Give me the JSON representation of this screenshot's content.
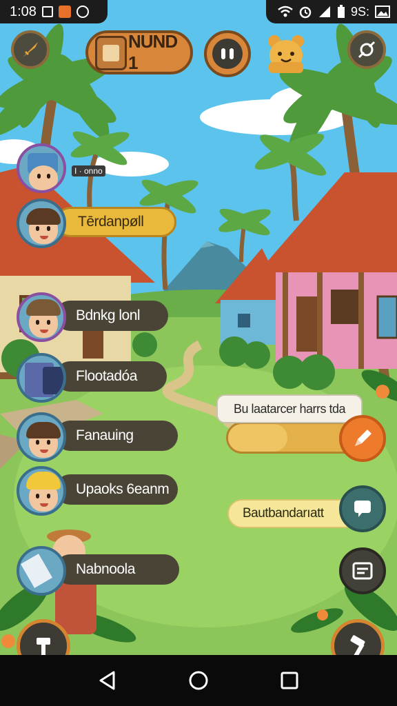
{
  "status_bar": {
    "time": "1:08",
    "battery_text": "9S:"
  },
  "hud": {
    "level_label": "NUND 1"
  },
  "characters": [
    {
      "label": ""
    },
    {
      "label": "Tērdanpøll"
    },
    {
      "label": "Bdnkg lonl"
    },
    {
      "label": "Flootadóa"
    },
    {
      "label": "Fanauing"
    },
    {
      "label": "Upaoks 6eanm"
    },
    {
      "label": "Nabnoola"
    }
  ],
  "mini_tag": "I · onno",
  "panels": {
    "tip_text": "Bu laatarcer harrs tda",
    "progress_fraction": 0.45,
    "task_label": "Bautbandarıatt"
  },
  "colors": {
    "sky": "#5cc3ec",
    "grass": "#8cc65a",
    "roof": "#c8532e",
    "hud_orange": "#d7863a",
    "panel_dark": "#4a4436",
    "fab_orange": "#ee7a2c"
  },
  "icons": {
    "hud_left": "sword-icon",
    "hud_right": "wrench-icon",
    "pause": "pause-icon",
    "fab_orange": "pencil-icon",
    "fab_teal": "chat-icon",
    "fab_dark": "card-icon",
    "corner_left": "hammer-icon",
    "corner_right": "hammer-icon"
  }
}
